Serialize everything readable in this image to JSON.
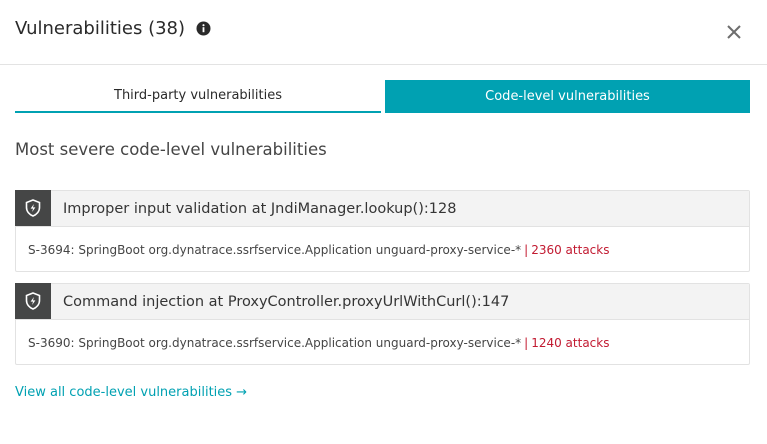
{
  "header": {
    "title": "Vulnerabilities (38)",
    "info_icon": "info-icon",
    "close_icon": "close-icon"
  },
  "tabs": [
    {
      "label": "Third-party vulnerabilities",
      "selected": false
    },
    {
      "label": "Code-level vulnerabilities",
      "selected": true
    }
  ],
  "section": {
    "title": "Most severe code-level vulnerabilities"
  },
  "vulnerabilities": [
    {
      "icon": "shield-icon",
      "title": "Improper input validation at JndiManager.lookup():128",
      "detail": "S-3694: SpringBoot org.dynatrace.ssrfservice.Application unguard-proxy-service-*",
      "separator": "|",
      "attacks": "2360 attacks"
    },
    {
      "icon": "shield-icon",
      "title": "Command injection at ProxyController.proxyUrlWithCurl():147",
      "detail": "S-3690: SpringBoot org.dynatrace.ssrfservice.Application unguard-proxy-service-*",
      "separator": "|",
      "attacks": "1240 attacks"
    }
  ],
  "footer": {
    "link_label": "View all code-level vulnerabilities",
    "arrow": "→"
  },
  "colors": {
    "accent": "#00a1b2",
    "danger": "#c21a31",
    "icon_bg": "#454646"
  }
}
